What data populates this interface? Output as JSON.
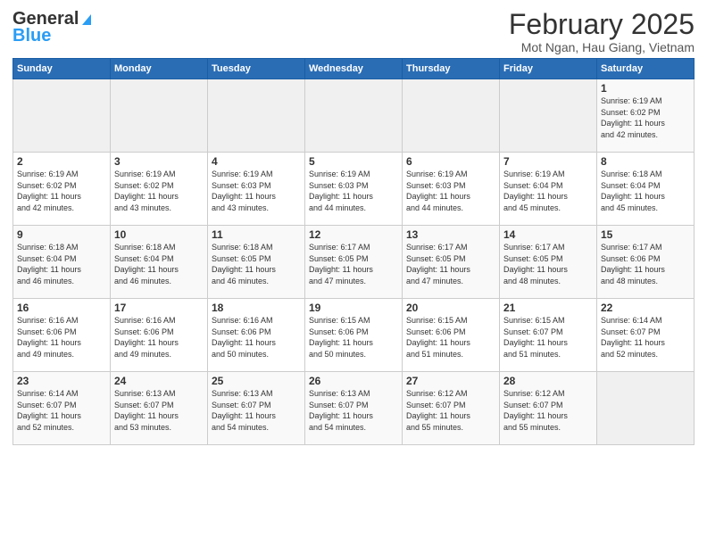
{
  "header": {
    "logo_general": "General",
    "logo_blue": "Blue",
    "title": "February 2025",
    "subtitle": "Mot Ngan, Hau Giang, Vietnam"
  },
  "weekdays": [
    "Sunday",
    "Monday",
    "Tuesday",
    "Wednesday",
    "Thursday",
    "Friday",
    "Saturday"
  ],
  "weeks": [
    [
      {
        "day": "",
        "info": ""
      },
      {
        "day": "",
        "info": ""
      },
      {
        "day": "",
        "info": ""
      },
      {
        "day": "",
        "info": ""
      },
      {
        "day": "",
        "info": ""
      },
      {
        "day": "",
        "info": ""
      },
      {
        "day": "1",
        "info": "Sunrise: 6:19 AM\nSunset: 6:02 PM\nDaylight: 11 hours\nand 42 minutes."
      }
    ],
    [
      {
        "day": "2",
        "info": "Sunrise: 6:19 AM\nSunset: 6:02 PM\nDaylight: 11 hours\nand 42 minutes."
      },
      {
        "day": "3",
        "info": "Sunrise: 6:19 AM\nSunset: 6:02 PM\nDaylight: 11 hours\nand 43 minutes."
      },
      {
        "day": "4",
        "info": "Sunrise: 6:19 AM\nSunset: 6:03 PM\nDaylight: 11 hours\nand 43 minutes."
      },
      {
        "day": "5",
        "info": "Sunrise: 6:19 AM\nSunset: 6:03 PM\nDaylight: 11 hours\nand 44 minutes."
      },
      {
        "day": "6",
        "info": "Sunrise: 6:19 AM\nSunset: 6:03 PM\nDaylight: 11 hours\nand 44 minutes."
      },
      {
        "day": "7",
        "info": "Sunrise: 6:19 AM\nSunset: 6:04 PM\nDaylight: 11 hours\nand 45 minutes."
      },
      {
        "day": "8",
        "info": "Sunrise: 6:18 AM\nSunset: 6:04 PM\nDaylight: 11 hours\nand 45 minutes."
      }
    ],
    [
      {
        "day": "9",
        "info": "Sunrise: 6:18 AM\nSunset: 6:04 PM\nDaylight: 11 hours\nand 46 minutes."
      },
      {
        "day": "10",
        "info": "Sunrise: 6:18 AM\nSunset: 6:04 PM\nDaylight: 11 hours\nand 46 minutes."
      },
      {
        "day": "11",
        "info": "Sunrise: 6:18 AM\nSunset: 6:05 PM\nDaylight: 11 hours\nand 46 minutes."
      },
      {
        "day": "12",
        "info": "Sunrise: 6:17 AM\nSunset: 6:05 PM\nDaylight: 11 hours\nand 47 minutes."
      },
      {
        "day": "13",
        "info": "Sunrise: 6:17 AM\nSunset: 6:05 PM\nDaylight: 11 hours\nand 47 minutes."
      },
      {
        "day": "14",
        "info": "Sunrise: 6:17 AM\nSunset: 6:05 PM\nDaylight: 11 hours\nand 48 minutes."
      },
      {
        "day": "15",
        "info": "Sunrise: 6:17 AM\nSunset: 6:06 PM\nDaylight: 11 hours\nand 48 minutes."
      }
    ],
    [
      {
        "day": "16",
        "info": "Sunrise: 6:16 AM\nSunset: 6:06 PM\nDaylight: 11 hours\nand 49 minutes."
      },
      {
        "day": "17",
        "info": "Sunrise: 6:16 AM\nSunset: 6:06 PM\nDaylight: 11 hours\nand 49 minutes."
      },
      {
        "day": "18",
        "info": "Sunrise: 6:16 AM\nSunset: 6:06 PM\nDaylight: 11 hours\nand 50 minutes."
      },
      {
        "day": "19",
        "info": "Sunrise: 6:15 AM\nSunset: 6:06 PM\nDaylight: 11 hours\nand 50 minutes."
      },
      {
        "day": "20",
        "info": "Sunrise: 6:15 AM\nSunset: 6:06 PM\nDaylight: 11 hours\nand 51 minutes."
      },
      {
        "day": "21",
        "info": "Sunrise: 6:15 AM\nSunset: 6:07 PM\nDaylight: 11 hours\nand 51 minutes."
      },
      {
        "day": "22",
        "info": "Sunrise: 6:14 AM\nSunset: 6:07 PM\nDaylight: 11 hours\nand 52 minutes."
      }
    ],
    [
      {
        "day": "23",
        "info": "Sunrise: 6:14 AM\nSunset: 6:07 PM\nDaylight: 11 hours\nand 52 minutes."
      },
      {
        "day": "24",
        "info": "Sunrise: 6:13 AM\nSunset: 6:07 PM\nDaylight: 11 hours\nand 53 minutes."
      },
      {
        "day": "25",
        "info": "Sunrise: 6:13 AM\nSunset: 6:07 PM\nDaylight: 11 hours\nand 54 minutes."
      },
      {
        "day": "26",
        "info": "Sunrise: 6:13 AM\nSunset: 6:07 PM\nDaylight: 11 hours\nand 54 minutes."
      },
      {
        "day": "27",
        "info": "Sunrise: 6:12 AM\nSunset: 6:07 PM\nDaylight: 11 hours\nand 55 minutes."
      },
      {
        "day": "28",
        "info": "Sunrise: 6:12 AM\nSunset: 6:07 PM\nDaylight: 11 hours\nand 55 minutes."
      },
      {
        "day": "",
        "info": ""
      }
    ]
  ]
}
